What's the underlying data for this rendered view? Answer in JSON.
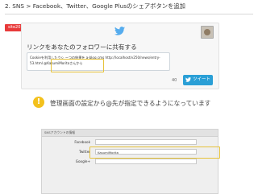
{
  "slide": {
    "title": "2. SNS > Facebook、Twitter、Google Plusのシェアボタンを追加",
    "site_badge": "site2015"
  },
  "share_dialog": {
    "heading": "リンクをあなたのフォロワーに共有する",
    "tweet_text_line1": "Cookieを利用したウシ ーつの結果を a-blog cms http://localhost/v250/news/entry-",
    "tweet_text_line2": "53.html @KasumiMoritaさんから",
    "char_count": "40",
    "tweet_button_label": "ツイート",
    "icons": {
      "logo": "twitter-bird-icon",
      "avatar": "user-avatar"
    },
    "colors": {
      "button": "#2a9fd6",
      "highlight": "#e6c23a"
    }
  },
  "caption": {
    "icon_text": "!",
    "text": "管理画面の設定から@先が指定できるようになっています"
  },
  "admin_form": {
    "title": "SNSアカウントの情報",
    "rows": [
      {
        "label": "Facebook",
        "value": ""
      },
      {
        "label": "Twitter",
        "value": "KasumiMorita"
      },
      {
        "label": "Google+",
        "value": ""
      }
    ]
  }
}
